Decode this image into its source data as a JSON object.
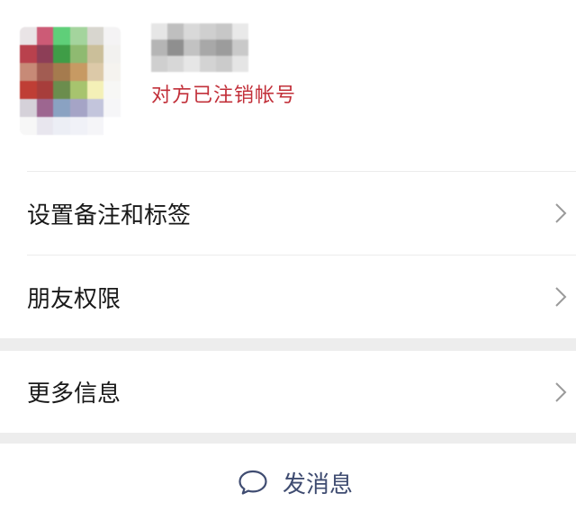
{
  "profile": {
    "status_text": "对方已注销帐号"
  },
  "menu": {
    "remark_label": "设置备注和标签",
    "permissions_label": "朋友权限",
    "more_info_label": "更多信息"
  },
  "send_message": {
    "label": "发消息"
  },
  "colors": {
    "status": "#c2303a",
    "send_label": "#3f4c71",
    "separator": "#ededed"
  },
  "icons": [
    "chevron-right-icon",
    "chat-bubble-icon"
  ]
}
